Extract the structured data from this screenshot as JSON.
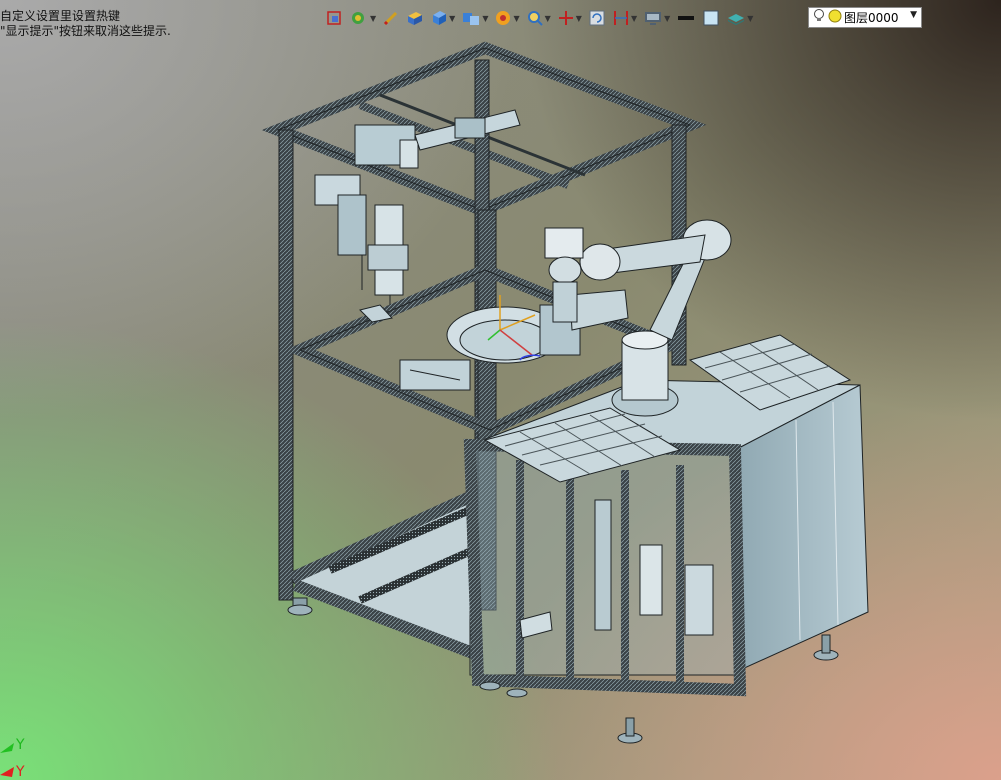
{
  "hint": {
    "line1": "自定义设置里设置热键",
    "line2": "\"显示提示\"按钮来取消这些提示."
  },
  "layer": {
    "name": "图层0000"
  },
  "ucs": {
    "y_label": "Y",
    "x_label": "Y"
  },
  "toolbar": {
    "icons": [
      "shape-icon",
      "rotate-view-icon",
      "sketch-pencil-icon",
      "solid-box-icon",
      "cube-icon",
      "render-mode-icon",
      "color-wheel-icon",
      "zoom-icon",
      "axis-icon",
      "refresh-icon",
      "section-icon",
      "display-monitor-icon",
      "line-color-icon",
      "fill-color-icon",
      "layer-stack-icon",
      "lightbulb-icon",
      "layer-status-icon"
    ]
  },
  "colors": {
    "frame": "#2c3235",
    "machine_body": "#a9c4cf",
    "highlight": "#dfe7ea"
  }
}
